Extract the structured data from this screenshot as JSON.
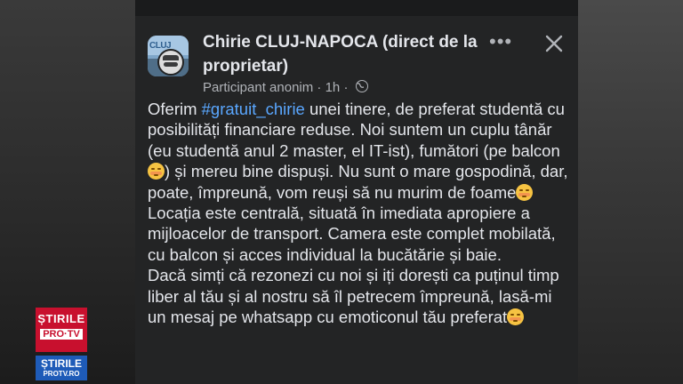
{
  "post": {
    "group_name": "Chirie CLUJ-NAPOCA (direct de la proprietar)",
    "author": "Participant anonim",
    "time": "1h",
    "privacy_icon": "globe-icon",
    "more_icon": "more-options-icon",
    "close_icon": "close-icon",
    "hashtag": "#gratuit_chirie",
    "avatar_text": "CLUJ",
    "text_1_before": "Oferim ",
    "text_1_after": " unei tinere, de preferat studentă cu posibilități financiare reduse. Noi suntem un cuplu tânăr (eu studentă anul 2 master, el IT-ist), fumători (pe balcon ",
    "text_1_after2": ") și mereu bine dispuși. Nu sunt o mare gospodină, dar, poate, împreună, vom reuși să nu murim de foame",
    "text_2": "Locația este centrală, situată în imediata apropiere a mijloacelor de transport. Camera este complet mobilată, cu balcon și acces individual la bucătărie și baie.",
    "text_3": "Dacă simți că rezonezi cu noi și iți dorești ca puținul timp liber al tău și al nostru să îl petrecem împreună, lasă-mi un mesaj pe whatsapp cu emoticonul tău preferat"
  },
  "watermark": {
    "line1": "ȘTIRILE",
    "line2": "PRO·TV",
    "line3": "ȘTIRILE",
    "line4": "PROTV.RO"
  },
  "colors": {
    "panel": "#232425",
    "text": "#e4e6eb",
    "secondary": "#b0b3b8",
    "link": "#5aa7ff",
    "brand_red": "#c8102e",
    "brand_blue": "#1e5bb8"
  }
}
